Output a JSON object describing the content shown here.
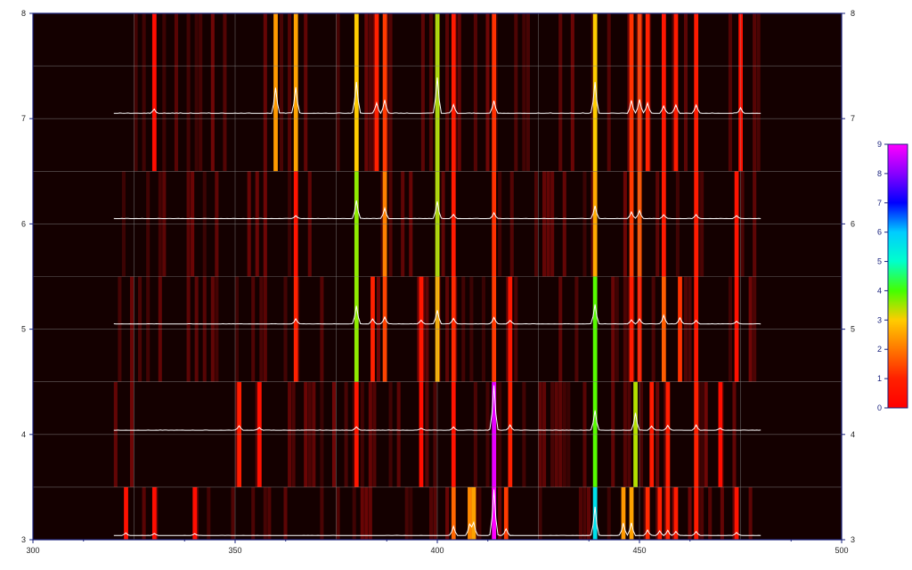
{
  "chart_data": {
    "type": "heatmap",
    "title": "",
    "xlabel": "",
    "ylabel": "",
    "xlim": [
      300,
      500
    ],
    "ylim": [
      3,
      8
    ],
    "x_ticks": [
      "300",
      "350",
      "400",
      "450",
      "500"
    ],
    "y_ticks": [
      "3",
      "4",
      "5",
      "6",
      "7",
      "8"
    ],
    "grid": true,
    "background_color": "#140000",
    "colorbar": {
      "range": [
        0,
        9
      ],
      "ticks": [
        "0",
        "1",
        "2",
        "3",
        "4",
        "5",
        "6",
        "7",
        "8",
        "9"
      ],
      "colormap": [
        "#ff0000",
        "#ffa500",
        "#ffff00",
        "#00ff00",
        "#00ffff",
        "#0000ff",
        "#ff00ff"
      ]
    },
    "trace_x_range": [
      320,
      480
    ],
    "rows": [
      {
        "y_range": [
          3,
          3.5
        ],
        "baseline": 3.04,
        "peaks": [
          {
            "x": 404,
            "v": 1.8
          },
          {
            "x": 408,
            "v": 2.2
          },
          {
            "x": 409,
            "v": 2.5
          },
          {
            "x": 414,
            "v": 9.0
          },
          {
            "x": 417,
            "v": 1.3
          },
          {
            "x": 439,
            "v": 5.6
          },
          {
            "x": 446,
            "v": 2.4
          },
          {
            "x": 448,
            "v": 2.5
          },
          {
            "x": 452,
            "v": 1.1
          },
          {
            "x": 455,
            "v": 0.9
          },
          {
            "x": 457,
            "v": 1.0
          },
          {
            "x": 459,
            "v": 0.8
          },
          {
            "x": 464,
            "v": 0.8
          },
          {
            "x": 474,
            "v": 0.6
          },
          {
            "x": 323,
            "v": 0.5
          },
          {
            "x": 330,
            "v": 0.4
          },
          {
            "x": 340,
            "v": 0.4
          }
        ]
      },
      {
        "y_range": [
          3.5,
          4.5
        ],
        "baseline": 4.04,
        "peaks": [
          {
            "x": 351,
            "v": 0.9
          },
          {
            "x": 356,
            "v": 0.5
          },
          {
            "x": 380,
            "v": 0.7
          },
          {
            "x": 414,
            "v": 8.8
          },
          {
            "x": 418,
            "v": 1.0
          },
          {
            "x": 439,
            "v": 3.9
          },
          {
            "x": 449,
            "v": 3.4
          },
          {
            "x": 453,
            "v": 0.8
          },
          {
            "x": 457,
            "v": 0.9
          },
          {
            "x": 464,
            "v": 1.0
          },
          {
            "x": 404,
            "v": 0.6
          },
          {
            "x": 396,
            "v": 0.4
          },
          {
            "x": 470,
            "v": 0.4
          }
        ]
      },
      {
        "y_range": [
          4.5,
          5.5
        ],
        "baseline": 5.05,
        "peaks": [
          {
            "x": 365,
            "v": 1.0
          },
          {
            "x": 380,
            "v": 3.6
          },
          {
            "x": 384,
            "v": 1.0
          },
          {
            "x": 387,
            "v": 1.4
          },
          {
            "x": 396,
            "v": 0.7
          },
          {
            "x": 400,
            "v": 2.7
          },
          {
            "x": 404,
            "v": 1.1
          },
          {
            "x": 414,
            "v": 1.3
          },
          {
            "x": 418,
            "v": 0.7
          },
          {
            "x": 439,
            "v": 3.9
          },
          {
            "x": 448,
            "v": 0.8
          },
          {
            "x": 450,
            "v": 1.0
          },
          {
            "x": 456,
            "v": 1.7
          },
          {
            "x": 460,
            "v": 1.2
          },
          {
            "x": 464,
            "v": 0.7
          },
          {
            "x": 474,
            "v": 0.5
          }
        ]
      },
      {
        "y_range": [
          5.5,
          6.5
        ],
        "baseline": 6.05,
        "peaks": [
          {
            "x": 380,
            "v": 3.6
          },
          {
            "x": 387,
            "v": 2.1
          },
          {
            "x": 400,
            "v": 3.4
          },
          {
            "x": 404,
            "v": 0.8
          },
          {
            "x": 414,
            "v": 1.2
          },
          {
            "x": 439,
            "v": 2.6
          },
          {
            "x": 448,
            "v": 1.3
          },
          {
            "x": 450,
            "v": 1.6
          },
          {
            "x": 456,
            "v": 0.8
          },
          {
            "x": 464,
            "v": 0.8
          },
          {
            "x": 474,
            "v": 0.6
          },
          {
            "x": 365,
            "v": 0.6
          }
        ]
      },
      {
        "y_range": [
          6.5,
          8
        ],
        "baseline": 7.05,
        "peaks": [
          {
            "x": 360,
            "v": 2.4
          },
          {
            "x": 365,
            "v": 2.5
          },
          {
            "x": 380,
            "v": 3.0
          },
          {
            "x": 385,
            "v": 1.0
          },
          {
            "x": 387,
            "v": 1.3
          },
          {
            "x": 400,
            "v": 3.4
          },
          {
            "x": 404,
            "v": 0.8
          },
          {
            "x": 414,
            "v": 1.2
          },
          {
            "x": 439,
            "v": 3.0
          },
          {
            "x": 448,
            "v": 1.2
          },
          {
            "x": 450,
            "v": 1.3
          },
          {
            "x": 452,
            "v": 1.0
          },
          {
            "x": 456,
            "v": 0.7
          },
          {
            "x": 459,
            "v": 0.8
          },
          {
            "x": 464,
            "v": 0.8
          },
          {
            "x": 475,
            "v": 0.5
          },
          {
            "x": 330,
            "v": 0.4
          }
        ]
      }
    ]
  }
}
